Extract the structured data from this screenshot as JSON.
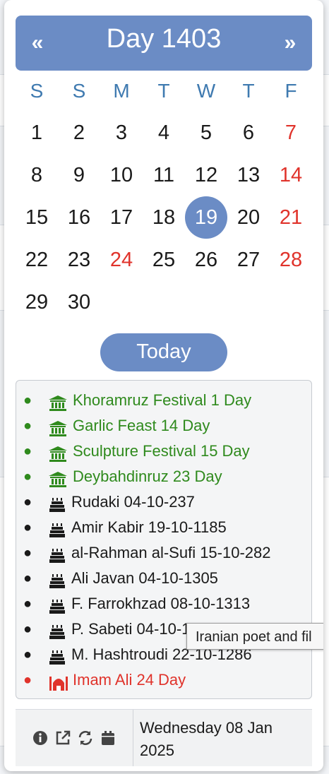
{
  "calendar": {
    "prev_label": "«",
    "title": "Day 1403",
    "next_label": "»",
    "weekdays": [
      "S",
      "S",
      "M",
      "T",
      "W",
      "T",
      "F"
    ],
    "weeks": [
      [
        {
          "d": "1"
        },
        {
          "d": "2"
        },
        {
          "d": "3"
        },
        {
          "d": "4"
        },
        {
          "d": "5"
        },
        {
          "d": "6"
        },
        {
          "d": "7",
          "red": true
        }
      ],
      [
        {
          "d": "8"
        },
        {
          "d": "9"
        },
        {
          "d": "10"
        },
        {
          "d": "11"
        },
        {
          "d": "12"
        },
        {
          "d": "13"
        },
        {
          "d": "14",
          "red": true
        }
      ],
      [
        {
          "d": "15"
        },
        {
          "d": "16"
        },
        {
          "d": "17"
        },
        {
          "d": "18"
        },
        {
          "d": "19",
          "selected": true
        },
        {
          "d": "20"
        },
        {
          "d": "21",
          "red": true
        }
      ],
      [
        {
          "d": "22"
        },
        {
          "d": "23"
        },
        {
          "d": "24",
          "red": true
        },
        {
          "d": "25"
        },
        {
          "d": "26"
        },
        {
          "d": "27"
        },
        {
          "d": "28",
          "red": true
        }
      ],
      [
        {
          "d": "29"
        },
        {
          "d": "30"
        }
      ]
    ],
    "today_label": "Today"
  },
  "events": [
    {
      "text": "Khoramruz Festival 1 Day",
      "kind": "green",
      "icon": "landmark-icon"
    },
    {
      "text": "Garlic Feast 14 Day",
      "kind": "green",
      "icon": "landmark-icon"
    },
    {
      "text": "Sculpture Festival 15 Day",
      "kind": "green",
      "icon": "landmark-icon"
    },
    {
      "text": "Deybahdinruz 23 Day",
      "kind": "green",
      "icon": "landmark-icon"
    },
    {
      "text": "Rudaki 04-10-237",
      "kind": "black",
      "icon": "birthday-cake-icon"
    },
    {
      "text": "Amir Kabir 19-10-1185",
      "kind": "black",
      "icon": "birthday-cake-icon"
    },
    {
      "text": "al-Rahman al-Sufi 15-10-282",
      "kind": "black",
      "icon": "birthday-cake-icon"
    },
    {
      "text": "Ali Javan 04-10-1305",
      "kind": "black",
      "icon": "birthday-cake-icon"
    },
    {
      "text": "F. Farrokhzad 08-10-1313",
      "kind": "black",
      "icon": "birthday-cake-icon"
    },
    {
      "text": "P. Sabeti 04-10-1354",
      "kind": "black",
      "icon": "birthday-cake-icon"
    },
    {
      "text": "M. Hashtroudi 22-10-1286",
      "kind": "black",
      "icon": "birthday-cake-icon"
    },
    {
      "text": "Imam Ali 24 Day",
      "kind": "red",
      "icon": "mosque-icon"
    }
  ],
  "tooltip": "Iranian poet and fil",
  "footer": {
    "date_line1": "Wednesday 08 Jan",
    "date_line2": "2025",
    "icons": [
      "info-icon",
      "external-link-icon",
      "sync-icon",
      "calendar-icon"
    ]
  },
  "colors": {
    "accent": "#6b8cc5",
    "holiday_red": "#e0332b",
    "event_green": "#2f8a1d",
    "weekday_blue": "#3f7ab0"
  }
}
